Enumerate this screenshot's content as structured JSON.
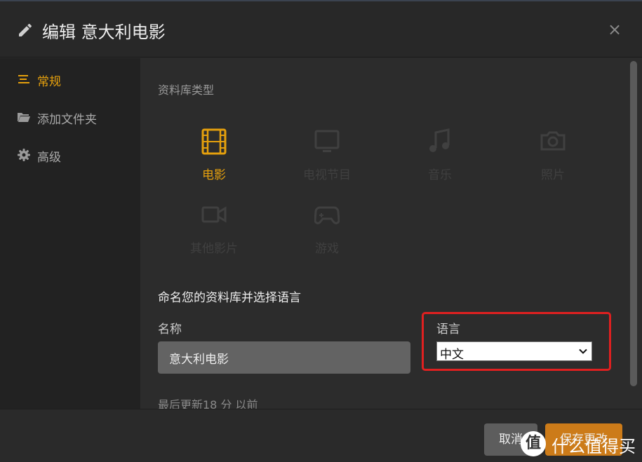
{
  "header": {
    "title": "编辑 意大利电影",
    "close_label": "×"
  },
  "sidebar": {
    "items": [
      {
        "label": "常规",
        "icon": "list-icon",
        "active": true
      },
      {
        "label": "添加文件夹",
        "icon": "folder-icon",
        "active": false
      },
      {
        "label": "高级",
        "icon": "gear-icon",
        "active": false
      }
    ]
  },
  "content": {
    "library_type_label": "资料库类型",
    "types": [
      {
        "label": "电影",
        "icon": "film-icon",
        "selected": true
      },
      {
        "label": "电视节目",
        "icon": "tv-icon",
        "selected": false
      },
      {
        "label": "音乐",
        "icon": "music-icon",
        "selected": false
      },
      {
        "label": "照片",
        "icon": "camera-icon",
        "selected": false
      },
      {
        "label": "其他影片",
        "icon": "video-camera-icon",
        "selected": false
      },
      {
        "label": "游戏",
        "icon": "gamepad-icon",
        "selected": false
      }
    ],
    "name_heading": "命名您的资料库并选择语言",
    "name_label": "名称",
    "name_value": "意大利电影",
    "language_label": "语言",
    "language_value": "中文",
    "updated_text": "最后更新18 分 以前"
  },
  "footer": {
    "cancel_label": "取消",
    "save_label": "保存更改"
  },
  "watermark": {
    "badge": "值",
    "text": "什么值得买"
  },
  "colors": {
    "accent": "#e5a00d",
    "save_button": "#cc7b19",
    "highlight_box": "#e02020"
  }
}
